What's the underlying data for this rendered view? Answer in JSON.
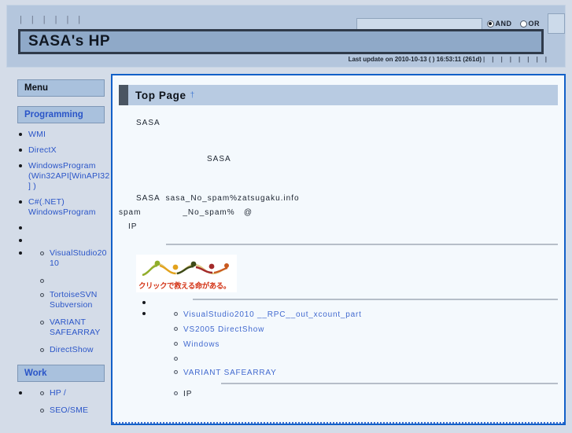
{
  "site": {
    "title": "SASA's HP",
    "last_update": "Last update on 2010-10-13 ( ) 16:53:11 (261d)"
  },
  "topnav": {
    "items": [
      "",
      "",
      "",
      "",
      "",
      ""
    ]
  },
  "search": {
    "value": "",
    "placeholder": "",
    "and_label": "AND",
    "or_label": "OR",
    "and_selected": true,
    "submit_label": ""
  },
  "sidebar": {
    "menu_label": "Menu",
    "programming_label": "Programming",
    "work_label": "Work",
    "programming_items": [
      {
        "label": "WMI"
      },
      {
        "label": "DirectX"
      },
      {
        "label": "WindowsProgram (Win32API[WinAPI32] )"
      },
      {
        "label": "C#(.NET)  WindowsProgram"
      },
      {
        "label": ""
      },
      {
        "label": ""
      },
      {
        "label": ""
      }
    ],
    "programming_subitems": [
      {
        "label": "VisualStudio2010"
      },
      {
        "label": ""
      },
      {
        "label": "TortoiseSVN  Subversion"
      },
      {
        "label": "VARIANT SAFEARRAY"
      },
      {
        "label": "DirectShow"
      }
    ],
    "work_items": [
      {
        "label": ""
      }
    ],
    "work_subitems": [
      {
        "label": "HP  /"
      },
      {
        "label": "SEO/SME"
      }
    ]
  },
  "content": {
    "page_title": "Top Page",
    "anchor": "†",
    "paragraphs": {
      "intro": "SASA",
      "middle": "SASA",
      "mail_line": "SASA  sasa_No_spam%zatsugaku.info",
      "spam_line": "spam              _No_spam%   @",
      "ip_line": "IP"
    },
    "banner": {
      "text": "クリックで救える命がある。",
      "name": "click-to-save-lives-banner"
    },
    "list_items": [
      {
        "label": ""
      },
      {
        "label": ""
      }
    ],
    "sub_links": [
      {
        "label": "VisualStudio2010    __RPC__out_xcount_part",
        "type": "link"
      },
      {
        "label": "VS2005   DirectShow",
        "type": "link"
      },
      {
        "label": "Windows",
        "type": "link"
      },
      {
        "label": "",
        "type": "link"
      },
      {
        "label": "VARIANT SAFEARRAY",
        "type": "link"
      },
      {
        "label": "IP",
        "type": "text"
      }
    ]
  },
  "colors": {
    "page_bg": "#d4dce8",
    "header_bg": "#b4c6dd",
    "title_bar": "#8fa9c8",
    "content_border": "#1260c8",
    "content_bg": "#f4f9fd",
    "link": "#2a55c8",
    "heading_bg": "#b8cbe2"
  }
}
